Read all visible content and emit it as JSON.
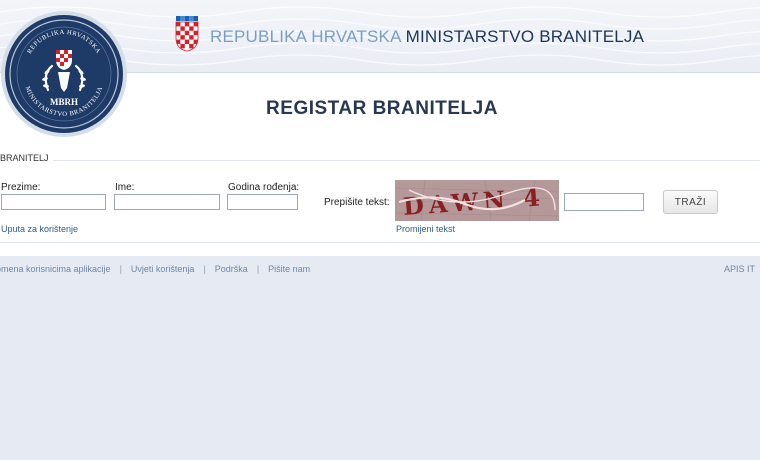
{
  "header": {
    "country": "REPUBLIKA HRVATSKA",
    "ministry": "MINISTARSTVO BRANITELJA"
  },
  "logo": {
    "top_text": "REPUBLIKA HRVATSKA",
    "center_text": "MBRH",
    "bottom_text": "MINISTARSTVO BRANITELJA"
  },
  "page": {
    "title": "REGISTAR BRANITELJA"
  },
  "form": {
    "legend": "BRANITELJ",
    "prezime_label": "Prezime:",
    "ime_label": "Ime:",
    "godina_label": "Godina rođenja:",
    "captcha_label": "Prepišite tekst:",
    "captcha_text": "DAWN 4",
    "search_button": "TRAŽI",
    "help_link": "Uputa za korištenje",
    "change_text_link": "Promijeni tekst",
    "prezime_value": "",
    "ime_value": "",
    "godina_value": "",
    "captcha_value": ""
  },
  "footer": {
    "links": [
      "omena korisnicima aplikacije",
      "Uvjeti korištenja",
      "Podrška",
      "Pišite nam"
    ],
    "right": "APIS IT"
  },
  "colors": {
    "header_light": "#7a9fc2",
    "header_dark": "#1d3558",
    "title": "#273850",
    "captcha_bg": "#b5989a",
    "captcha_ink": "#8a1f1f",
    "page_bg": "#e6ebf3"
  }
}
